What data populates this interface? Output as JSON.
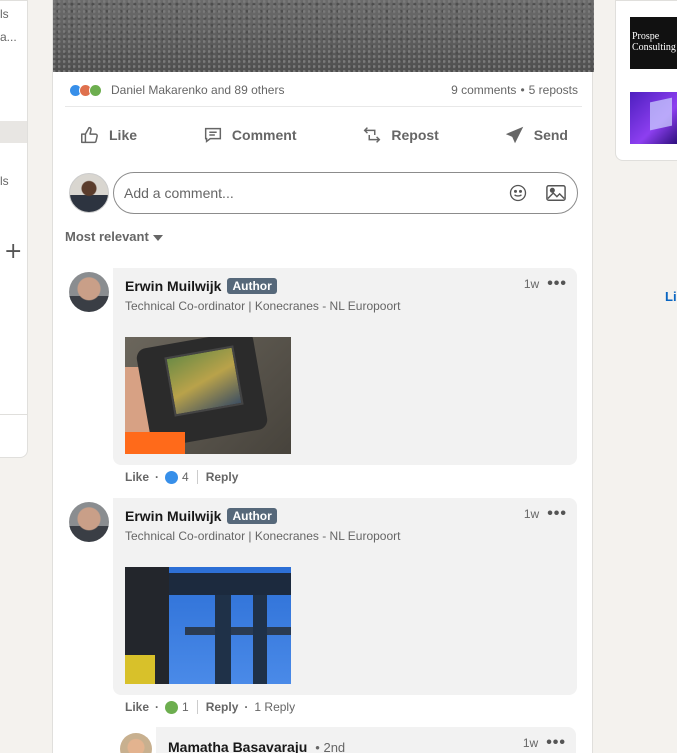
{
  "left_rail": {
    "snippet_1": "ls",
    "snippet_2": "a...",
    "snippet_3": "ls",
    "plus_label": "+"
  },
  "post": {
    "reactions_text": "Daniel Makarenko and 89 others",
    "comments_count": "9 comments",
    "reposts_count": "5 reposts",
    "separator": "•",
    "actions": {
      "like": "Like",
      "comment": "Comment",
      "repost": "Repost",
      "send": "Send"
    },
    "comment_placeholder": "Add a comment...",
    "sort_label": "Most relevant"
  },
  "comments": [
    {
      "author": "Erwin Muilwijk",
      "badge": "Author",
      "headline": "Technical Co-ordinator | Konecranes - NL Europoort",
      "time": "1w",
      "like_label": "Like",
      "dot": "·",
      "reaction_count": "4",
      "reply_label": "Reply",
      "reply_count": ""
    },
    {
      "author": "Erwin Muilwijk",
      "badge": "Author",
      "headline": "Technical Co-ordinator | Konecranes - NL Europoort",
      "time": "1w",
      "like_label": "Like",
      "dot": "·",
      "reaction_count": "1",
      "reply_label": "Reply",
      "reply_count": "1 Reply"
    }
  ],
  "reply": {
    "author": "Mamatha Basavaraju",
    "degree": "• 2nd",
    "time": "1w"
  },
  "right_rail": {
    "ad1_text_line1": "Prospe",
    "ad1_text_line2": "Consulting",
    "link_text": "Li"
  },
  "colors": {
    "like_blue": "#378fe9",
    "author_badge": "#56687a",
    "link_blue": "#0a66c2"
  }
}
